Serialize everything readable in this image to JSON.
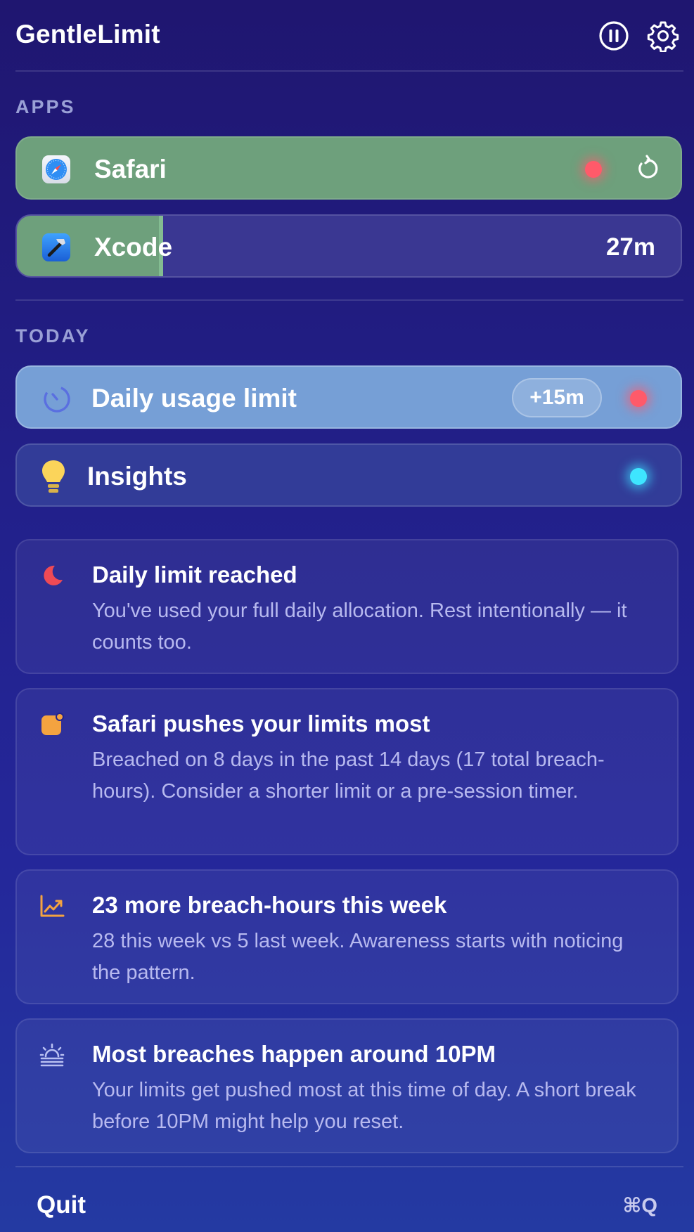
{
  "header": {
    "title": "GentleLimit"
  },
  "apps": {
    "label": "APPS",
    "items": [
      {
        "name": "Safari",
        "usage_fraction": 1.0,
        "status": "limit-reached"
      },
      {
        "name": "Xcode",
        "time": "27m",
        "usage_fraction": 0.22
      }
    ]
  },
  "today": {
    "label": "TODAY",
    "daily_limit": {
      "label": "Daily usage limit",
      "extend": "+15m"
    },
    "insights": {
      "label": "Insights"
    }
  },
  "insights": [
    {
      "icon": "moon-icon",
      "title": "Daily limit reached",
      "body": "You've used your full daily allocation. Rest intentionally — it counts too."
    },
    {
      "icon": "app-badge-icon",
      "title": "Safari pushes your limits most",
      "body": "Breached on 8 days in the past 14 days (17 total breach-hours). Consider a shorter limit or a pre-session timer."
    },
    {
      "icon": "trend-up-icon",
      "title": "23 more breach-hours this week",
      "body": "28 this week vs 5 last week. Awareness starts with noticing the pattern."
    },
    {
      "icon": "sunset-icon",
      "title": "Most breaches happen around 10PM",
      "body": "Your limits get pushed most at this time of day. A short break before 10PM might help you reset."
    }
  ],
  "footer": {
    "quit": "Quit",
    "shortcut": "⌘Q"
  },
  "colors": {
    "usage_green": "#6ea07c",
    "alert_red": "#ff5a6a",
    "insight_cyan": "#3ee5ff",
    "accent_orange": "#f4a340",
    "moon_red": "#ef4a55"
  }
}
